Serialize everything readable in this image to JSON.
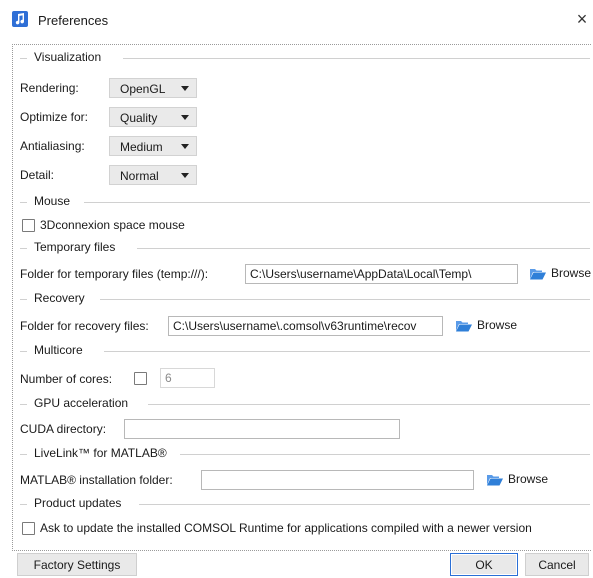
{
  "window": {
    "title": "Preferences",
    "close_symbol": "×"
  },
  "sections": {
    "visualization": "Visualization",
    "mouse": "Mouse",
    "temporary_files": "Temporary files",
    "recovery": "Recovery",
    "multicore": "Multicore",
    "gpu": "GPU acceleration",
    "livelink": "LiveLink™ for MATLAB®",
    "product_updates": "Product updates"
  },
  "visualization": {
    "rendering": {
      "label": "Rendering:",
      "value": "OpenGL"
    },
    "optimize": {
      "label": "Optimize for:",
      "value": "Quality"
    },
    "antialiasing": {
      "label": "Antialiasing:",
      "value": "Medium"
    },
    "detail": {
      "label": "Detail:",
      "value": "Normal"
    }
  },
  "mouse": {
    "space_mouse_label": "3Dconnexion space mouse",
    "space_mouse_checked": false
  },
  "temporary_files": {
    "folder_label": "Folder for temporary files (temp:///):",
    "folder_value": "C:\\Users\\username\\AppData\\Local\\Temp\\",
    "browse_label": "Browse"
  },
  "recovery": {
    "folder_label": "Folder for recovery files:",
    "folder_value": "C:\\Users\\username\\.comsol\\v63runtime\\recov",
    "browse_label": "Browse"
  },
  "multicore": {
    "cores_label": "Number of cores:",
    "cores_checked": false,
    "cores_value": "6"
  },
  "gpu": {
    "cuda_label": "CUDA directory:",
    "cuda_value": ""
  },
  "livelink": {
    "matlab_label": "MATLAB® installation folder:",
    "matlab_value": "",
    "browse_label": "Browse"
  },
  "product_updates": {
    "ask_label": "Ask to update the installed COMSOL Runtime for applications compiled with a newer version",
    "ask_checked": false
  },
  "footer": {
    "factory_label": "Factory Settings",
    "ok_label": "OK",
    "cancel_label": "Cancel"
  },
  "colors": {
    "accent": "#2a6fd6",
    "folder_icon": "#2f7fd8"
  }
}
